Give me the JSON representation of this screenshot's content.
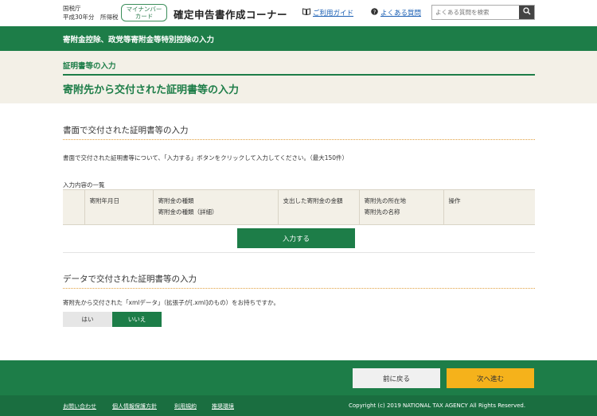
{
  "header": {
    "agency_line1": "国税庁",
    "agency_line2": "平成30年分　所得税",
    "mynumber_line1": "マイナンバー",
    "mynumber_line2": "カード",
    "site_title": "確定申告書作成コーナー",
    "guide_link": "ご利用ガイド",
    "faq_link": "よくある質問",
    "search_placeholder": "よくある質問を検索"
  },
  "band_title": "寄附金控除、政党等寄附金等特別控除の入力",
  "section_label": "証明書等の入力",
  "page_title": "寄附先から交付された証明書等の入力",
  "paper": {
    "heading": "書面で交付された証明書等の入力",
    "instruction": "書面で交付された証明書等について、「入力する」ボタンをクリックして入力してください。（最大150件）",
    "list_caption": "入力内容の一覧",
    "columns": [
      {
        "l1": "",
        "l2": ""
      },
      {
        "l1": "寄附年月日",
        "l2": ""
      },
      {
        "l1": "寄附金の種類",
        "l2": "寄附金の種類（詳細）"
      },
      {
        "l1": "支出した寄附金の金額",
        "l2": ""
      },
      {
        "l1": "寄附先の所在地",
        "l2": "寄附先の名称"
      },
      {
        "l1": "操作",
        "l2": ""
      }
    ],
    "add_button": "入力する"
  },
  "data": {
    "heading": "データで交付された証明書等の入力",
    "question": "寄附先から交付された「xmlデータ」（拡張子が[.xml]のもの）をお持ちですか。",
    "yes": "はい",
    "no": "いいえ"
  },
  "footer": {
    "back": "前に戻る",
    "next": "次へ進む",
    "links": [
      "お問い合わせ",
      "個人情報保護方針",
      "利用規約",
      "推奨環境"
    ],
    "copyright": "Copyright (c) 2019 NATIONAL TAX AGENCY All Rights Reserved."
  }
}
